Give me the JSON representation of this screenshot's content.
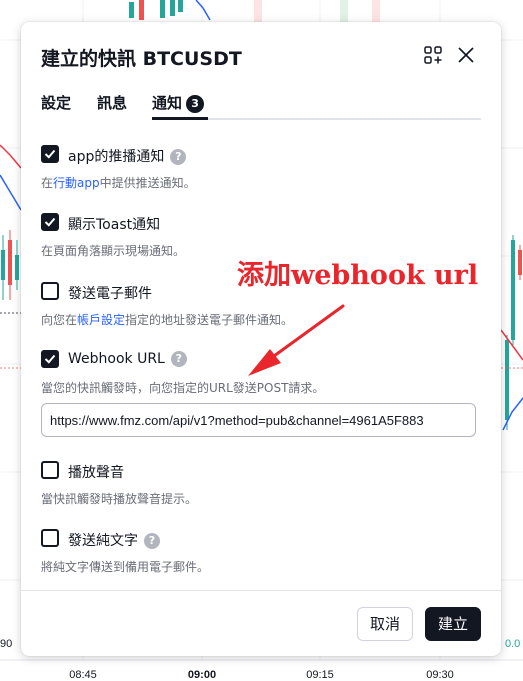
{
  "colors": {
    "text": "#131722",
    "muted": "#6a6d78",
    "link": "#2962ff",
    "accent_dark": "#131722",
    "annotation": "#e8262b",
    "candle_up": "#26a69a",
    "candle_down": "#ef5350",
    "line_blue": "#2962ff",
    "line_red": "#f23645"
  },
  "chart_bg": {
    "time_axis": [
      {
        "label": "08:45",
        "bold": false
      },
      {
        "label": "09:00",
        "bold": true
      },
      {
        "label": "09:15",
        "bold": false
      },
      {
        "label": "09:30",
        "bold": false
      }
    ],
    "left_edge_label": "90",
    "right_edge_label": "0.0"
  },
  "dialog": {
    "title": "建立的快訊 BTCUSDT",
    "icons": {
      "add": "add-widget-icon",
      "close": "close-icon"
    },
    "tabs": [
      {
        "label": "設定",
        "active": false
      },
      {
        "label": "訊息",
        "active": false
      },
      {
        "label": "通知",
        "active": true,
        "badge": "3"
      }
    ],
    "options": [
      {
        "label": "app的推播通知",
        "checked": true,
        "has_help": true,
        "desc_prefix": "在",
        "desc_link": "行動app",
        "desc_suffix": "中提供推送通知。"
      },
      {
        "label": "顯示Toast通知",
        "checked": true,
        "has_help": false,
        "desc": "在頁面角落顯示現場通知。"
      },
      {
        "label": "發送電子郵件",
        "checked": false,
        "has_help": false,
        "desc_prefix": "向您在",
        "desc_link": "帳戶設定",
        "desc_suffix": "指定的地址發送電子郵件通知。"
      },
      {
        "label": "Webhook URL",
        "checked": true,
        "has_help": true,
        "desc": "當您的快訊觸發時，向您指定的URL發送POST請求。"
      },
      {
        "label": "播放聲音",
        "checked": false,
        "has_help": false,
        "desc": "當快訊觸發時播放聲音提示。"
      },
      {
        "label": "發送純文字",
        "checked": false,
        "has_help": true,
        "desc": "將純文字傳送到備用電子郵件。"
      }
    ],
    "webhook_url_value": "https://www.fmz.com/api/v1?method=pub&channel=4961A5F883",
    "help_glyph": "?",
    "buttons": {
      "cancel": "取消",
      "create": "建立"
    }
  },
  "annotation": {
    "text": "添加webhook url"
  }
}
